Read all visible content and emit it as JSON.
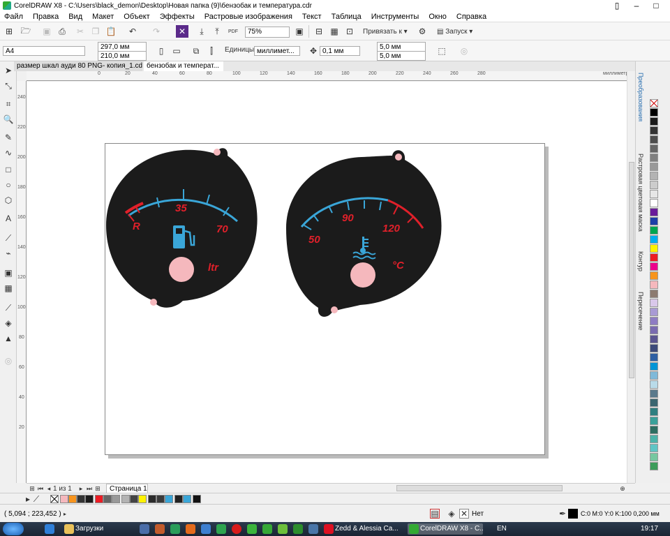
{
  "window": {
    "title": "CorelDRAW X8 - C:\\Users\\black_demon\\Desktop\\Новая папка (9)\\бензобак и температура.cdr"
  },
  "menu": [
    "Файл",
    "Правка",
    "Вид",
    "Макет",
    "Объект",
    "Эффекты",
    "Растровые изображения",
    "Текст",
    "Таблица",
    "Инструменты",
    "Окно",
    "Справка"
  ],
  "toolbar": {
    "zoom": "75%",
    "snap_label": "Привязать к",
    "launch_label": "Запуск",
    "pdf_label": "PDF"
  },
  "props": {
    "page_size": "A4",
    "width": "297,0 мм",
    "height": "210,0 мм",
    "units_label": "Единицы:",
    "units_value": "миллимет...",
    "nudge": "0,1 мм",
    "dup_x": "5,0 мм",
    "dup_y": "5,0 мм"
  },
  "tabs": [
    "размер шкал ауди 80 PNG- копия_1.cdr",
    "бензобак и температ..."
  ],
  "ruler": {
    "unit": "миллиметры",
    "top_ticks": [
      "0",
      "20",
      "40",
      "60",
      "80",
      "100",
      "120",
      "140",
      "160",
      "180",
      "200",
      "220",
      "240",
      "260",
      "280"
    ],
    "left_ticks": [
      "240",
      "220",
      "200",
      "180",
      "160",
      "140",
      "120",
      "100",
      "80",
      "60",
      "40",
      "20"
    ]
  },
  "dockers": [
    "Преобразования",
    "Растровая цветовая маска",
    "Контур",
    "Пересечение"
  ],
  "navigator": {
    "page_of": "1 из 1",
    "page_tab": "Страница 1"
  },
  "status": {
    "coords": "( 5,094 ; 223,452 )",
    "fill_label": "Нет",
    "outline_info": "C:0 M:0 Y:0 K:100  0,200 мм"
  },
  "fuel_gauge": {
    "labels": [
      "R",
      "35",
      "70"
    ],
    "unit": "ltr"
  },
  "temp_gauge": {
    "labels": [
      "50",
      "90",
      "120"
    ],
    "unit": "°C"
  },
  "colors": {
    "dial": "#1b1b1b",
    "scale_blue": "#3aa6d8",
    "scale_red": "#e0202a",
    "dot_pink": "#f5b8bd"
  },
  "taskbar": {
    "items": [
      "Загрузки",
      "Zedd & Alessia Ca...",
      "CorelDRAW X8 - C..."
    ],
    "lang": "EN",
    "clock": "19:17"
  }
}
